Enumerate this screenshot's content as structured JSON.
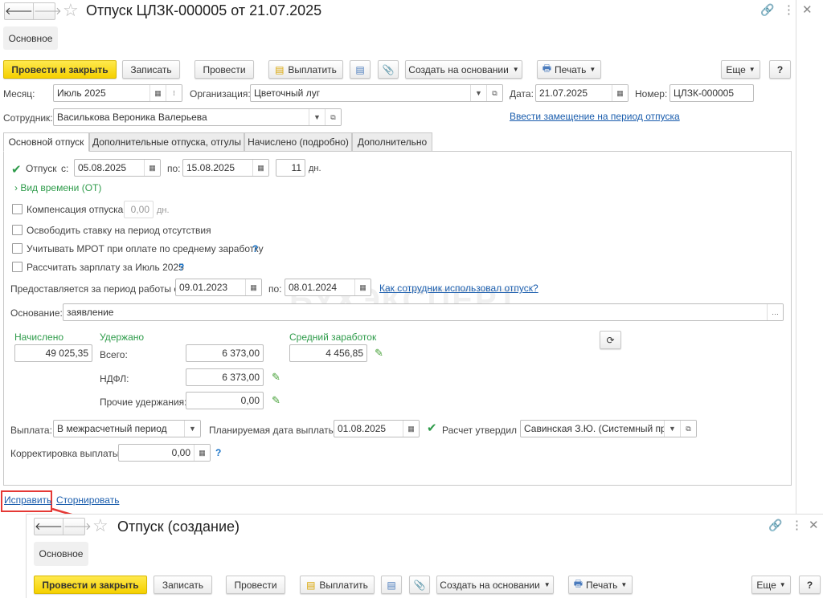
{
  "window": {
    "title": "Отпуск ЦЛЗК-000005 от 21.07.2025",
    "section_tab": "Основное"
  },
  "toolbar": {
    "post_close": "Провести и закрыть",
    "save": "Записать",
    "post": "Провести",
    "pay": "Выплатить",
    "create_based": "Создать на основании",
    "print": "Печать",
    "more": "Еще",
    "help": "?"
  },
  "header": {
    "month_label": "Месяц:",
    "month": "Июль 2025",
    "org_label": "Организация:",
    "org": "Цветочный луг",
    "date_label": "Дата:",
    "date": "21.07.2025",
    "number_label": "Номер:",
    "number": "ЦЛЗК-000005",
    "employee_label": "Сотрудник:",
    "employee": "Василькова Вероника Валерьева",
    "replace_link": "Ввести замещение на период отпуска"
  },
  "tabs": [
    "Основной отпуск",
    "Дополнительные отпуска, отгулы",
    "Начислено (подробно)",
    "Дополнительно"
  ],
  "main": {
    "vacation_label": "Отпуск",
    "from_label": "с:",
    "from": "05.08.2025",
    "to_label": "по:",
    "to": "15.08.2025",
    "days": "11",
    "days_unit": "дн.",
    "time_type": "Вид времени (ОТ)",
    "compensation_label": "Компенсация отпуска",
    "compensation_value": "0,00",
    "compensation_unit": "дн.",
    "free_rate": "Освободить ставку на период отсутствия",
    "mrot": "Учитывать МРОТ при оплате по среднему заработку",
    "calc_salary": "Рассчитать зарплату за Июль 2025",
    "period_label": "Предоставляется за период работы с:",
    "period_from": "09.01.2023",
    "period_to_label": "по:",
    "period_to": "08.01.2024",
    "usage_link": "Как сотрудник использовал отпуск?",
    "basis_label": "Основание:",
    "basis": "заявление",
    "accrued_label": "Начислено",
    "accrued": "49 025,35",
    "withheld_label": "Удержано",
    "total_label": "Всего:",
    "total": "6 373,00",
    "ndfl_label": "НДФЛ:",
    "ndfl": "6 373,00",
    "other_label": "Прочие удержания:",
    "other": "0,00",
    "avg_label": "Средний заработок",
    "avg": "4 456,85",
    "payout_label": "Выплата:",
    "payout": "В межрасчетный период",
    "plan_date_label": "Планируемая дата выплаты:",
    "plan_date": "01.08.2025",
    "approved_label": "Расчет утвердил",
    "approved_by": "Савинская З.Ю. (Системный прог",
    "correction_label": "Корректировка выплаты:",
    "correction": "0,00",
    "help": "?"
  },
  "watermark": "БУХЭКСПЕРТ",
  "bottom_links": {
    "fix": "Исправить",
    "reverse": "Сторнировать"
  },
  "second_window": {
    "title": "Отпуск (создание)",
    "section_tab": "Основное",
    "post_close": "Провести и закрыть",
    "save": "Записать",
    "post": "Провести",
    "pay": "Выплатить",
    "create_based": "Создать на основании",
    "print": "Печать",
    "more": "Еще",
    "help": "?"
  },
  "colors": {
    "accent_yellow": "#f5d000",
    "green": "#2e9b4a",
    "link": "#1a5dad",
    "highlight": "#e53935"
  }
}
